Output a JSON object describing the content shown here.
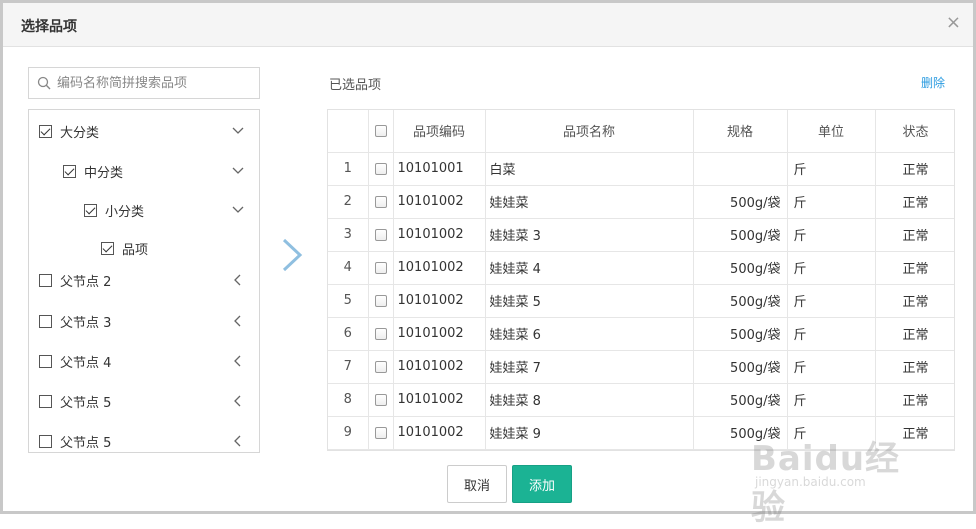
{
  "dialog": {
    "title": "选择品项",
    "close": "×"
  },
  "search": {
    "placeholder": "编码名称简拼搜索品项",
    "value": ""
  },
  "tree": [
    {
      "label": "大分类",
      "checked": true,
      "expand": "down"
    },
    {
      "label": "中分类",
      "checked": true,
      "expand": "down"
    },
    {
      "label": "小分类",
      "checked": true,
      "expand": "down"
    },
    {
      "label": "品项",
      "checked": true,
      "expand": "none"
    },
    {
      "label": "父节点 2",
      "checked": false,
      "expand": "left"
    },
    {
      "label": "父节点 3",
      "checked": false,
      "expand": "left"
    },
    {
      "label": "父节点 4",
      "checked": false,
      "expand": "left"
    },
    {
      "label": "父节点 5",
      "checked": false,
      "expand": "left"
    },
    {
      "label": "父节点 5",
      "checked": false,
      "expand": "left"
    }
  ],
  "selected": {
    "title": "已选品项",
    "delete_label": "删除",
    "columns": [
      "",
      "",
      "品项编码",
      "品项名称",
      "规格",
      "单位",
      "状态"
    ],
    "rows": [
      {
        "idx": "1",
        "code": "10101001",
        "name": "白菜",
        "spec": "",
        "unit": "斤",
        "status": "正常"
      },
      {
        "idx": "2",
        "code": "10101002",
        "name": "娃娃菜",
        "spec": "500g/袋",
        "unit": "斤",
        "status": "正常"
      },
      {
        "idx": "3",
        "code": "10101002",
        "name": "娃娃菜 3",
        "spec": "500g/袋",
        "unit": "斤",
        "status": "正常"
      },
      {
        "idx": "4",
        "code": "10101002",
        "name": "娃娃菜 4",
        "spec": "500g/袋",
        "unit": "斤",
        "status": "正常"
      },
      {
        "idx": "5",
        "code": "10101002",
        "name": "娃娃菜 5",
        "spec": "500g/袋",
        "unit": "斤",
        "status": "正常"
      },
      {
        "idx": "6",
        "code": "10101002",
        "name": "娃娃菜 6",
        "spec": "500g/袋",
        "unit": "斤",
        "status": "正常"
      },
      {
        "idx": "7",
        "code": "10101002",
        "name": "娃娃菜 7",
        "spec": "500g/袋",
        "unit": "斤",
        "status": "正常"
      },
      {
        "idx": "8",
        "code": "10101002",
        "name": "娃娃菜 8",
        "spec": "500g/袋",
        "unit": "斤",
        "status": "正常"
      },
      {
        "idx": "9",
        "code": "10101002",
        "name": "娃娃菜 9",
        "spec": "500g/袋",
        "unit": "斤",
        "status": "正常"
      }
    ]
  },
  "buttons": {
    "cancel": "取消",
    "add": "添加"
  },
  "watermark": {
    "logo": "Baidu经验",
    "url": "jingyan.baidu.com"
  },
  "colors": {
    "accent": "#1bb394",
    "link": "#2a9be0",
    "arrow": "#8fbfe0"
  }
}
